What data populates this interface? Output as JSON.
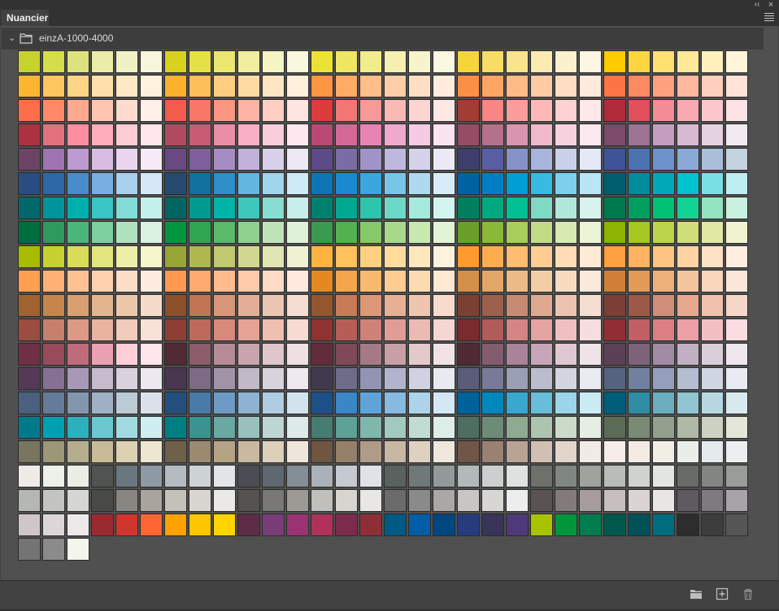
{
  "window": {
    "collapse_glyph": "‹‹",
    "close_glyph": "×"
  },
  "panel": {
    "tab_label": "Nuancier",
    "menu_icon": "hamburger-menu-icon"
  },
  "group": {
    "name": "einzA-1000-4000",
    "expanded": true,
    "icon": "folder-icon"
  },
  "swatches": [
    "#c8d22d",
    "#d6dd4a",
    "#dde27e",
    "#e9eda9",
    "#f0f2c6",
    "#f5f6dc",
    "#d8d21e",
    "#e5e045",
    "#eae871",
    "#f0ef9f",
    "#f5f4c3",
    "#f9f8dc",
    "#ece136",
    "#efe661",
    "#f2ec8c",
    "#f5f0b0",
    "#f7f4cc",
    "#faf8e1",
    "#f5d53c",
    "#f7dc66",
    "#f9e48d",
    "#fbebb1",
    "#fcf1cd",
    "#fdf6e2",
    "#ffcc00",
    "#ffd640",
    "#ffe070",
    "#ffe999",
    "#fff0bd",
    "#fff6da",
    "#fbb631",
    "#fdc65e",
    "#fed488",
    "#ffe0aa",
    "#ffe9c5",
    "#fff1dd",
    "#fbb12d",
    "#fdbf57",
    "#ffce80",
    "#ffdba4",
    "#ffe6c3",
    "#fff0dd",
    "#fd9642",
    "#feab64",
    "#ffbd87",
    "#ffcea6",
    "#ffdec4",
    "#ffecdd",
    "#fd8f45",
    "#fea565",
    "#ffba87",
    "#ffcba5",
    "#ffdcc3",
    "#ffeadb",
    "#fd7445",
    "#fe8a62",
    "#ffa17f",
    "#ffb89e",
    "#ffcfbd",
    "#ffe3d8",
    "#ff6e4a",
    "#ff8a69",
    "#ffa890",
    "#ffc4b2",
    "#ffdccf",
    "#fff0ea",
    "#f45c4d",
    "#f87766",
    "#fb9683",
    "#fdb3a3",
    "#ffcfc3",
    "#ffe6e0",
    "#dc3c3b",
    "#f07774",
    "#f59a96",
    "#f9bab6",
    "#fcd4d1",
    "#fee8e6",
    "#a23c35",
    "#f78684",
    "#fa9e9c",
    "#fcb9b7",
    "#fdd2d1",
    "#ffe8e8",
    "#b12c3b",
    "#e24f5d",
    "#f48c98",
    "#f8a9b2",
    "#fbc7cd",
    "#fde3e6",
    "#ae3141",
    "#e1727d",
    "#fd8ea0",
    "#ffadbb",
    "#ffcbd4",
    "#ffe6ea",
    "#b14a60",
    "#c85b74",
    "#e88fa7",
    "#f6afc3",
    "#fbcddb",
    "#fee7ee",
    "#ba4874",
    "#d46996",
    "#e784b3",
    "#f0a8cc",
    "#f7cae3",
    "#fbe4f0",
    "#954c64",
    "#b5718a",
    "#d796ad",
    "#efb8cb",
    "#f7d2de",
    "#fce9ef",
    "#7d4a6b",
    "#9f7394",
    "#c59ec0",
    "#d8b9d3",
    "#e4d2e2",
    "#f2eaf1",
    "#6b4466",
    "#9e75b2",
    "#bc99ce",
    "#d8bde2",
    "#ead5ee",
    "#f5eaf6",
    "#684982",
    "#7e5f9b",
    "#a58dc4",
    "#c1b2dc",
    "#d8d0ea",
    "#ece8f4",
    "#5c4b86",
    "#7a6ca6",
    "#9f94c8",
    "#bfb8de",
    "#d6d2ec",
    "#ece9f6",
    "#3e3e6b",
    "#575ea4",
    "#8492c8",
    "#a8b4db",
    "#c9d1e9",
    "#e3e8f4",
    "#3d5596",
    "#4b73b1",
    "#6d93cc",
    "#8ba9d6",
    "#a9bfd9",
    "#c5d3df",
    "#2a4c82",
    "#2e68a6",
    "#4a8bcb",
    "#79aee0",
    "#a9cfee",
    "#d5e8f8",
    "#25496f",
    "#12709f",
    "#2f8fc8",
    "#64b7e1",
    "#a0d5ee",
    "#cfeaf7",
    "#0d75b4",
    "#1a8ad0",
    "#3aa7e0",
    "#78c5ea",
    "#add9f1",
    "#d7ecf8",
    "#0062a3",
    "#007fc4",
    "#009ed4",
    "#38bae2",
    "#7cd0ec",
    "#b8e6f5",
    "#005e6e",
    "#008c9c",
    "#00a9b8",
    "#00c3cf",
    "#7adfe4",
    "#bfeff1",
    "#00676d",
    "#00959a",
    "#00aeb0",
    "#38c6c6",
    "#83dbd8",
    "#c3efec",
    "#006560",
    "#009a91",
    "#00b3a7",
    "#3dc8bb",
    "#88ddd3",
    "#c6efea",
    "#00816f",
    "#00a890",
    "#2fc4ac",
    "#6dd8c5",
    "#a6e9dd",
    "#d3f5ef",
    "#00805f",
    "#00a880",
    "#00bf95",
    "#7fd9c5",
    "#b0e8da",
    "#d7f4ec",
    "#007a4d",
    "#009f60",
    "#00c174",
    "#13d394",
    "#93e3c0",
    "#c8f1df",
    "#006d3d",
    "#2f9a5d",
    "#4ab67c",
    "#7ccf9f",
    "#b0e2c2",
    "#d8f1e1",
    "#009640",
    "#2fa752",
    "#5ab96a",
    "#8fd08e",
    "#bfe3b8",
    "#def1d9",
    "#3a9a4d",
    "#53b150",
    "#86c96a",
    "#a8d98a",
    "#c8e8b0",
    "#e3f3d6",
    "#6aa02a",
    "#8ab93a",
    "#a8cd5a",
    "#c2dc85",
    "#d8eab0",
    "#ebf4d6",
    "#8cb400",
    "#a6c621",
    "#bcd34c",
    "#d0df7a",
    "#e0e9a4",
    "#eff4cf",
    "#a8bc00",
    "#c6d130",
    "#d8dc58",
    "#e3e67f",
    "#edefa8",
    "#f5f6cc",
    "#98a534",
    "#aeb84e",
    "#c1c86e",
    "#d2d78f",
    "#e1e5b1",
    "#eff1d3",
    "#ffb43f",
    "#ffc25d",
    "#ffd07e",
    "#ffdc9e",
    "#ffe7bd",
    "#fff2dc",
    "#ff9a2e",
    "#ffac4e",
    "#ffbd70",
    "#ffcd92",
    "#ffdcb3",
    "#ffebd5",
    "#ff9f40",
    "#ffb260",
    "#ffc382",
    "#ffd3a3",
    "#ffe1c3",
    "#ffeedf",
    "#ff9f4f",
    "#ffb072",
    "#ffc192",
    "#ffd1af",
    "#ffdec9",
    "#ffebdf",
    "#ff9851",
    "#ffaa6f",
    "#ffbb8e",
    "#ffcba8",
    "#ffdac4",
    "#ffe9de",
    "#e4891f",
    "#f5a54b",
    "#f9ba6f",
    "#fccc93",
    "#fedab1",
    "#ffe9d2",
    "#d38f47",
    "#e3a665",
    "#ecbc86",
    "#f3cea5",
    "#f8dcc0",
    "#fbeadb",
    "#d17f36",
    "#e39a58",
    "#eeb07b",
    "#f5c59e",
    "#f9d6bc",
    "#fce7d9",
    "#a0622f",
    "#c6864b",
    "#d8a070",
    "#e3b58e",
    "#ecc8aa",
    "#f5dcc8",
    "#8e4f2b",
    "#c07653",
    "#d79677",
    "#e2af96",
    "#ebc6b2",
    "#f5ddd0",
    "#95552d",
    "#c97b56",
    "#dc9877",
    "#e6b094",
    "#efc5ae",
    "#f7dccd",
    "#7a4031",
    "#9b5f4c",
    "#c68b73",
    "#dfa98f",
    "#ebc3ae",
    "#f5ddd1",
    "#7c3f35",
    "#9e5848",
    "#d08e78",
    "#e6a990",
    "#f0c1ad",
    "#f6d6c9",
    "#9b4d3f",
    "#c6806c",
    "#dc9a86",
    "#e8b39f",
    "#f1cbbb",
    "#f8e2d8",
    "#8f3e36",
    "#bd6a5c",
    "#d7897b",
    "#e4a394",
    "#eebeb1",
    "#f7dad1",
    "#8f3232",
    "#b75d58",
    "#cf817a",
    "#e09c96",
    "#ebbab4",
    "#f4d6d3",
    "#7a2b2e",
    "#b25b5b",
    "#d48584",
    "#e5a3a2",
    "#efc0bf",
    "#f7dddd",
    "#912e34",
    "#c25e66",
    "#dc7f85",
    "#eba1a6",
    "#f3bfc3",
    "#f9dde0",
    "#702f44",
    "#9a4a5d",
    "#bf6b7e",
    "#eba1b3",
    "#fecfd9",
    "#ffe6eb",
    "#522a33",
    "#8c5d6a",
    "#b58c98",
    "#caa4ad",
    "#dfc5cc",
    "#efe0e3",
    "#632c3a",
    "#804958",
    "#a67a85",
    "#c7a0a7",
    "#e3c9cb",
    "#f1e3e4",
    "#4f2a34",
    "#835d6e",
    "#a98498",
    "#c6a6b6",
    "#dec9d2",
    "#efe3e8",
    "#5c4156",
    "#7e627a",
    "#a28ba4",
    "#c1afc3",
    "#dacfd9",
    "#eee8ee",
    "#553a57",
    "#867194",
    "#a898b8",
    "#c6bace",
    "#dad1de",
    "#ece8ef",
    "#4a3650",
    "#7d6b85",
    "#a294a8",
    "#c1b9c8",
    "#d8d2dc",
    "#ede9ef",
    "#403a4f",
    "#6e6c89",
    "#9394b3",
    "#b2b4cd",
    "#d0d2e1",
    "#e8e9f1",
    "#5a5c7a",
    "#777b98",
    "#9a9fb6",
    "#b9bdcd",
    "#d3d6e0",
    "#eaebf1",
    "#56637e",
    "#7280a0",
    "#949fbd",
    "#b4bdd1",
    "#d0d6e2",
    "#e8ebf1",
    "#4a607e",
    "#647c99",
    "#8396ae",
    "#9fb2c5",
    "#bccad6",
    "#d9e2ea",
    "#234f7d",
    "#4a7aa8",
    "#6d9bc6",
    "#8db2d2",
    "#b0cce1",
    "#d3e3ee",
    "#1e5088",
    "#3a86c6",
    "#5fa3d8",
    "#87badf",
    "#add3ea",
    "#d3e8f4",
    "#00629a",
    "#0088bd",
    "#3aa7cf",
    "#68bdd9",
    "#9ad5e8",
    "#cbebf4",
    "#005e7a",
    "#2f8ca4",
    "#6aaec0",
    "#91c5d1",
    "#b7d8e0",
    "#d8eaee",
    "#007a8a",
    "#00a0b2",
    "#2db0bd",
    "#6cc7d0",
    "#a1dbe1",
    "#cfeef1",
    "#007e84",
    "#3b938f",
    "#6aa8a4",
    "#98c1bd",
    "#bdd6d3",
    "#dcebe9",
    "#457d72",
    "#5ea197",
    "#80b7ac",
    "#a0cabf",
    "#c0dcd3",
    "#ddede8",
    "#4e6e60",
    "#6c8c78",
    "#8eab92",
    "#adc4ae",
    "#ccdbc9",
    "#e6eee3",
    "#5a6b56",
    "#7a8b74",
    "#93a08d",
    "#b0b8a6",
    "#ccd1c1",
    "#e3e6d9",
    "#787560",
    "#9b9777",
    "#b4ae8e",
    "#c7bc97",
    "#dcd2b2",
    "#eee6d0",
    "#6e6049",
    "#9b8a6f",
    "#b5a386",
    "#c8b9a0",
    "#ddd0bb",
    "#efe6da",
    "#6e5640",
    "#958069",
    "#b09c86",
    "#c8b7a2",
    "#dfd1c0",
    "#efe7dd",
    "#6f5646",
    "#9a8172",
    "#b9a393",
    "#d0bfb2",
    "#e2d6cc",
    "#f1ebe5",
    "#f6ecea",
    "#f4ece4",
    "#f0efe4",
    "#e9efe8",
    "#e4ebea",
    "#eceff0",
    "#efebe6",
    "#eef0ea",
    "#eaeee4",
    "#4f5352",
    "#6a777f",
    "#8e9ba4",
    "#b4bcc1",
    "#cdd2d4",
    "#e3e5e6",
    "#4a4e54",
    "#5f6871",
    "#838e96",
    "#aab1b8",
    "#c4cad0",
    "#dfe2e6",
    "#5a6260",
    "#6e7978",
    "#929b9a",
    "#b3b9b8",
    "#cccfcf",
    "#e0e2e2",
    "#6d7169",
    "#808780",
    "#9ea39c",
    "#b9bdb7",
    "#cfd2cd",
    "#e3e5e1",
    "#696b66",
    "#828580",
    "#9a9c99",
    "#b5b7b5",
    "#c4c5c2",
    "#d6d7d4",
    "#4a4b47",
    "#888681",
    "#a9a59e",
    "#c4c0ba",
    "#d9d6d0",
    "#ebe9e5",
    "#555350",
    "#797874",
    "#9b9a95",
    "#c0bfba",
    "#d6d5d0",
    "#e8e7e3",
    "#6b6b6b",
    "#8a8a8a",
    "#aaa7a5",
    "#c8c5c2",
    "#d8d6d3",
    "#ededed",
    "#5b5252",
    "#837b7b",
    "#a79c9c",
    "#c7bebe",
    "#dbd4d4",
    "#eae5e5",
    "#5e5a5f",
    "#7e7a80",
    "#a7a3a9",
    "#cfc6c9",
    "#ddd6d8",
    "#ede8e9",
    "#9b2a30",
    "#d1362e",
    "#ff6633",
    "#ffa100",
    "#ffc600",
    "#ffd400",
    "#5e2c46",
    "#7a3c79",
    "#9a3374",
    "#b0325b",
    "#7d2b4c",
    "#8e2f37",
    "#005b84",
    "#005ea8",
    "#00467f",
    "#263c7f",
    "#383558",
    "#4f3a79",
    "#a8c400",
    "#009639",
    "#007c4f",
    "#00594c",
    "#005258",
    "#006d7e",
    "#2d2d2d",
    "#3d3d3d",
    "#565656",
    "#747474",
    "#8b8b8b",
    "#f5f5ee"
  ],
  "footer": {
    "new_group_icon": "folder-icon",
    "new_swatch_icon": "new-swatch-icon",
    "delete_icon": "trash-icon"
  }
}
